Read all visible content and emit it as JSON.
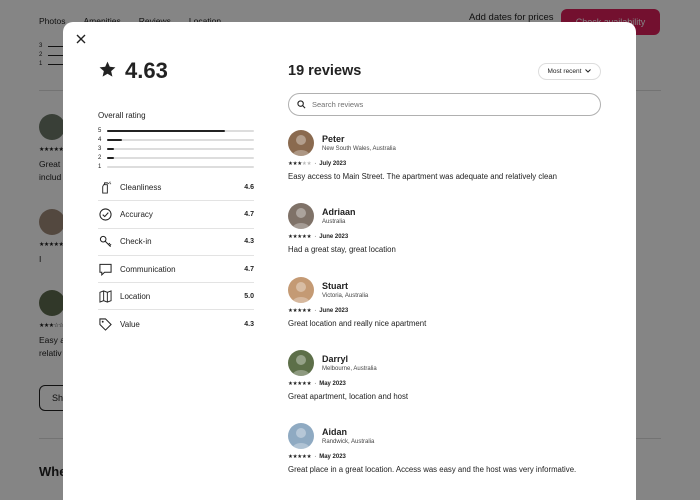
{
  "background": {
    "nav": [
      "Photos",
      "Amenities",
      "Reviews",
      "Location"
    ],
    "price_prompt": "Add dates for prices",
    "check_availability": "Check availability",
    "rating_numbers": [
      "3",
      "2",
      "1"
    ],
    "snippets": [
      "Great",
      "includ",
      "I",
      "Easy a",
      "relativ"
    ],
    "show_button": "Sh",
    "where_heading": "Whe"
  },
  "modal": {
    "close_icon": "close-icon",
    "overall": {
      "star_icon": "star-icon",
      "rating": "4.63",
      "label": "Overall rating"
    },
    "distribution": [
      {
        "stars": "5",
        "fraction": 0.8
      },
      {
        "stars": "4",
        "fraction": 0.1
      },
      {
        "stars": "3",
        "fraction": 0.05
      },
      {
        "stars": "2",
        "fraction": 0.05
      },
      {
        "stars": "1",
        "fraction": 0
      }
    ],
    "categories": [
      {
        "icon": "spray-bottle-icon",
        "name": "Cleanliness",
        "value": "4.6"
      },
      {
        "icon": "check-circle-icon",
        "name": "Accuracy",
        "value": "4.7"
      },
      {
        "icon": "key-icon",
        "name": "Check-in",
        "value": "4.3"
      },
      {
        "icon": "chat-bubble-icon",
        "name": "Communication",
        "value": "4.7"
      },
      {
        "icon": "map-icon",
        "name": "Location",
        "value": "5.0"
      },
      {
        "icon": "tag-icon",
        "name": "Value",
        "value": "4.3"
      }
    ],
    "reviews_title": "19 reviews",
    "sort_label": "Most recent",
    "search_placeholder": "Search reviews",
    "reviews": [
      {
        "name": "Peter",
        "location": "New South Wales, Australia",
        "stars": 3,
        "date": "July 2023",
        "text": "Easy access to Main Street. The apartment was adequate and relatively clean",
        "avatar_color": "#8a6a4f"
      },
      {
        "name": "Adriaan",
        "location": "Australia",
        "stars": 5,
        "date": "June 2023",
        "text": "Had a great stay, great location",
        "avatar_color": "#7f7268"
      },
      {
        "name": "Stuart",
        "location": "Victoria, Australia",
        "stars": 5,
        "date": "June 2023",
        "text": "Great location and really nice apartment",
        "avatar_color": "#c49a74"
      },
      {
        "name": "Darryl",
        "location": "Melbourne, Australia",
        "stars": 5,
        "date": "May 2023",
        "text": "Great apartment, location and host",
        "avatar_color": "#5d6f49"
      },
      {
        "name": "Aidan",
        "location": "Randwick, Australia",
        "stars": 5,
        "date": "May 2023",
        "text": "Great place in a great location. Access was easy and the host was very informative.",
        "avatar_color": "#8faac2"
      }
    ],
    "separator": "·"
  }
}
